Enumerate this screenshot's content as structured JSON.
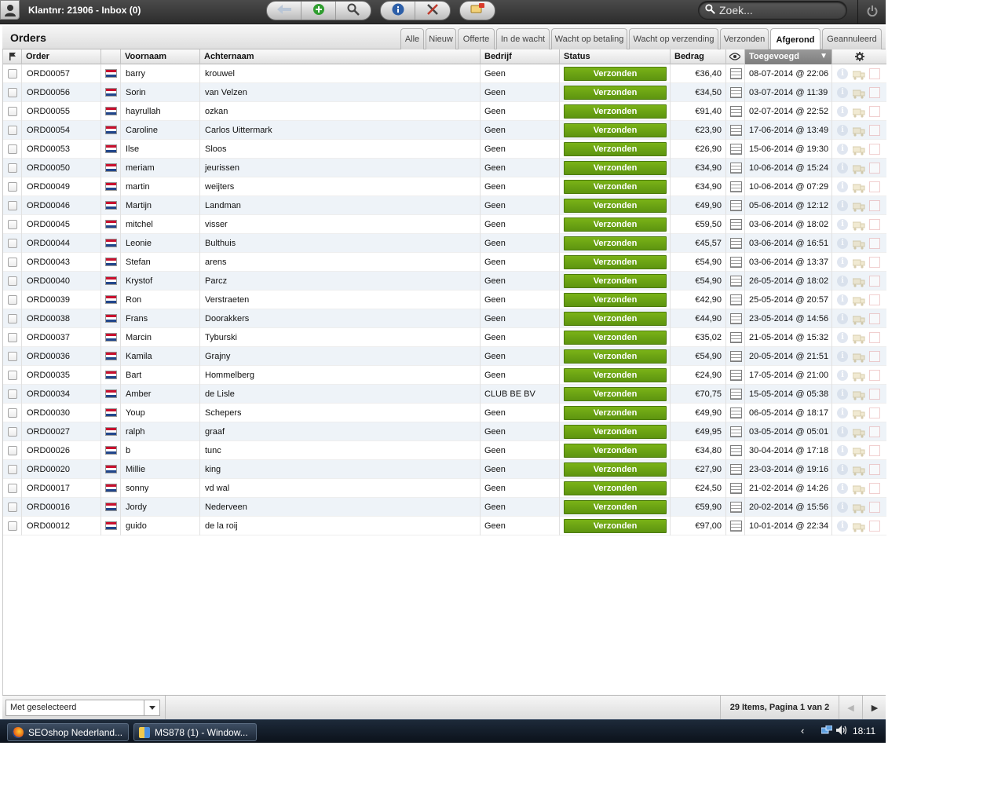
{
  "topbar": {
    "title": "Klantnr: 21906 - Inbox (0)",
    "search_placeholder": "Zoek..."
  },
  "page": {
    "title": "Orders",
    "tabs": [
      "Alle",
      "Nieuw",
      "Offerte",
      "In de wacht",
      "Wacht op betaling",
      "Wacht op verzending",
      "Verzonden",
      "Afgerond",
      "Geannuleerd"
    ],
    "active_tab": "Afgerond"
  },
  "table": {
    "headers": {
      "order": "Order",
      "first": "Voornaam",
      "last": "Achternaam",
      "company": "Bedrijf",
      "status": "Status",
      "amount": "Bedrag",
      "added": "Toegevoegd"
    },
    "sort_column": "Toegevoegd",
    "rows": [
      {
        "order": "ORD00057",
        "first": "barry",
        "last": "krouwel",
        "company": "Geen",
        "status": "Verzonden",
        "amount": "€36,40",
        "added": "08-07-2014 @ 22:06"
      },
      {
        "order": "ORD00056",
        "first": "Sorin",
        "last": "van Velzen",
        "company": "Geen",
        "status": "Verzonden",
        "amount": "€34,50",
        "added": "03-07-2014 @ 11:39"
      },
      {
        "order": "ORD00055",
        "first": "hayrullah",
        "last": "ozkan",
        "company": "Geen",
        "status": "Verzonden",
        "amount": "€91,40",
        "added": "02-07-2014 @ 22:52"
      },
      {
        "order": "ORD00054",
        "first": "Caroline",
        "last": "Carlos Uittermark",
        "company": "Geen",
        "status": "Verzonden",
        "amount": "€23,90",
        "added": "17-06-2014 @ 13:49"
      },
      {
        "order": "ORD00053",
        "first": "Ilse",
        "last": "Sloos",
        "company": "Geen",
        "status": "Verzonden",
        "amount": "€26,90",
        "added": "15-06-2014 @ 19:30"
      },
      {
        "order": "ORD00050",
        "first": "meriam",
        "last": "jeurissen",
        "company": "Geen",
        "status": "Verzonden",
        "amount": "€34,90",
        "added": "10-06-2014 @ 15:24"
      },
      {
        "order": "ORD00049",
        "first": "martin",
        "last": "weijters",
        "company": "Geen",
        "status": "Verzonden",
        "amount": "€34,90",
        "added": "10-06-2014 @ 07:29"
      },
      {
        "order": "ORD00046",
        "first": "Martijn",
        "last": "Landman",
        "company": "Geen",
        "status": "Verzonden",
        "amount": "€49,90",
        "added": "05-06-2014 @ 12:12"
      },
      {
        "order": "ORD00045",
        "first": "mitchel",
        "last": "visser",
        "company": "Geen",
        "status": "Verzonden",
        "amount": "€59,50",
        "added": "03-06-2014 @ 18:02"
      },
      {
        "order": "ORD00044",
        "first": "Leonie",
        "last": "Bulthuis",
        "company": "Geen",
        "status": "Verzonden",
        "amount": "€45,57",
        "added": "03-06-2014 @ 16:51"
      },
      {
        "order": "ORD00043",
        "first": "Stefan",
        "last": "arens",
        "company": "Geen",
        "status": "Verzonden",
        "amount": "€54,90",
        "added": "03-06-2014 @ 13:37"
      },
      {
        "order": "ORD00040",
        "first": "Krystof",
        "last": "Parcz",
        "company": "Geen",
        "status": "Verzonden",
        "amount": "€54,90",
        "added": "26-05-2014 @ 18:02"
      },
      {
        "order": "ORD00039",
        "first": "Ron",
        "last": "Verstraeten",
        "company": "Geen",
        "status": "Verzonden",
        "amount": "€42,90",
        "added": "25-05-2014 @ 20:57"
      },
      {
        "order": "ORD00038",
        "first": "Frans",
        "last": "Doorakkers",
        "company": "Geen",
        "status": "Verzonden",
        "amount": "€44,90",
        "added": "23-05-2014 @ 14:56"
      },
      {
        "order": "ORD00037",
        "first": "Marcin",
        "last": "Tyburski",
        "company": "Geen",
        "status": "Verzonden",
        "amount": "€35,02",
        "added": "21-05-2014 @ 15:32"
      },
      {
        "order": "ORD00036",
        "first": "Kamila",
        "last": "Grajny",
        "company": "Geen",
        "status": "Verzonden",
        "amount": "€54,90",
        "added": "20-05-2014 @ 21:51"
      },
      {
        "order": "ORD00035",
        "first": "Bart",
        "last": "Hommelberg",
        "company": "Geen",
        "status": "Verzonden",
        "amount": "€24,90",
        "added": "17-05-2014 @ 21:00"
      },
      {
        "order": "ORD00034",
        "first": "Amber",
        "last": "de Lisle",
        "company": "CLUB BE BV",
        "status": "Verzonden",
        "amount": "€70,75",
        "added": "15-05-2014 @ 05:38"
      },
      {
        "order": "ORD00030",
        "first": "Youp",
        "last": "Schepers",
        "company": "Geen",
        "status": "Verzonden",
        "amount": "€49,90",
        "added": "06-05-2014 @ 18:17"
      },
      {
        "order": "ORD00027",
        "first": "ralph",
        "last": "graaf",
        "company": "Geen",
        "status": "Verzonden",
        "amount": "€49,95",
        "added": "03-05-2014 @ 05:01"
      },
      {
        "order": "ORD00026",
        "first": "b",
        "last": "tunc",
        "company": "Geen",
        "status": "Verzonden",
        "amount": "€34,80",
        "added": "30-04-2014 @ 17:18"
      },
      {
        "order": "ORD00020",
        "first": "Millie",
        "last": "king",
        "company": "Geen",
        "status": "Verzonden",
        "amount": "€27,90",
        "added": "23-03-2014 @ 19:16"
      },
      {
        "order": "ORD00017",
        "first": "sonny",
        "last": "vd wal",
        "company": "Geen",
        "status": "Verzonden",
        "amount": "€24,50",
        "added": "21-02-2014 @ 14:26"
      },
      {
        "order": "ORD00016",
        "first": "Jordy",
        "last": "Nederveen",
        "company": "Geen",
        "status": "Verzonden",
        "amount": "€59,90",
        "added": "20-02-2014 @ 15:56"
      },
      {
        "order": "ORD00012",
        "first": "guido",
        "last": "de la roij",
        "company": "Geen",
        "status": "Verzonden",
        "amount": "€97,00",
        "added": "10-01-2014 @ 22:34"
      }
    ]
  },
  "footer": {
    "bulk_action": "Met geselecteerd",
    "pager": "29 Items, Pagina 1 van 2"
  },
  "taskbar": {
    "tasks": [
      "SEOshop Nederland...",
      "MS878 (1) - Window..."
    ],
    "clock": "18:11"
  },
  "colors": {
    "status_shipped": "#6aa313",
    "row_alt": "#eef3f8",
    "topbar": "#3a3a3a"
  },
  "icons": {
    "topbar_buttons": [
      "back-arrow-icon",
      "add-icon",
      "search-icon",
      "info-icon",
      "tools-icon",
      "notifications-icon"
    ],
    "row_actions": [
      "info-icon",
      "truck-icon",
      "document-icon"
    ]
  }
}
